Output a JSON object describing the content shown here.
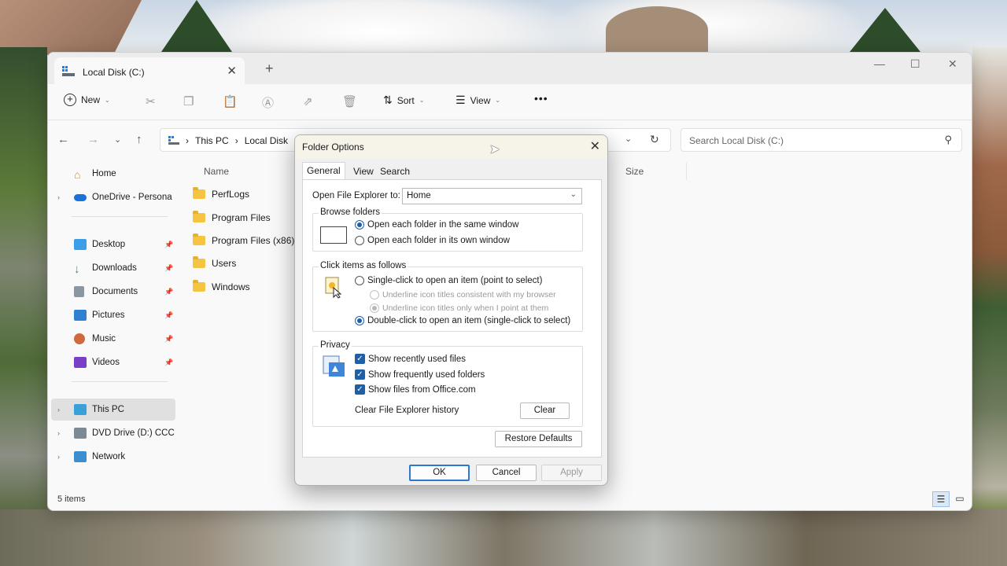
{
  "explorer": {
    "tab_title": "Local Disk (C:)",
    "toolbar": {
      "new_label": "New",
      "sort_label": "Sort",
      "view_label": "View",
      "more_label": "•••"
    },
    "breadcrumbs": [
      "This PC",
      "Local Disk"
    ],
    "search_placeholder": "Search Local Disk (C:)",
    "sidebar": {
      "home": "Home",
      "onedrive": "OneDrive - Persona",
      "desktop": "Desktop",
      "downloads": "Downloads",
      "documents": "Documents",
      "pictures": "Pictures",
      "music": "Music",
      "videos": "Videos",
      "this_pc": "This PC",
      "dvd": "DVD Drive (D:) CCC",
      "network": "Network"
    },
    "columns": {
      "name": "Name",
      "size": "Size"
    },
    "files": [
      "PerfLogs",
      "Program Files",
      "Program Files (x86)",
      "Users",
      "Windows"
    ],
    "status": "5 items"
  },
  "dialog": {
    "title": "Folder Options",
    "tabs": [
      "General",
      "View",
      "Search"
    ],
    "open_to_label": "Open File Explorer to:",
    "open_to_value": "Home",
    "browse_group": "Browse folders",
    "browse_same": "Open each folder in the same window",
    "browse_own": "Open each folder in its own window",
    "click_group": "Click items as follows",
    "single_click": "Single-click to open an item (point to select)",
    "underline_browser": "Underline icon titles consistent with my browser",
    "underline_point": "Underline icon titles only when I point at them",
    "double_click": "Double-click to open an item (single-click to select)",
    "privacy_group": "Privacy",
    "recent_files": "Show recently used files",
    "frequent_folders": "Show frequently used folders",
    "office_files": "Show files from Office.com",
    "clear_history_label": "Clear File Explorer history",
    "clear_button": "Clear",
    "restore_defaults": "Restore Defaults",
    "ok": "OK",
    "cancel": "Cancel",
    "apply": "Apply"
  },
  "colors": {
    "accent": "#1f5fa8",
    "folder": "#f5c542"
  }
}
